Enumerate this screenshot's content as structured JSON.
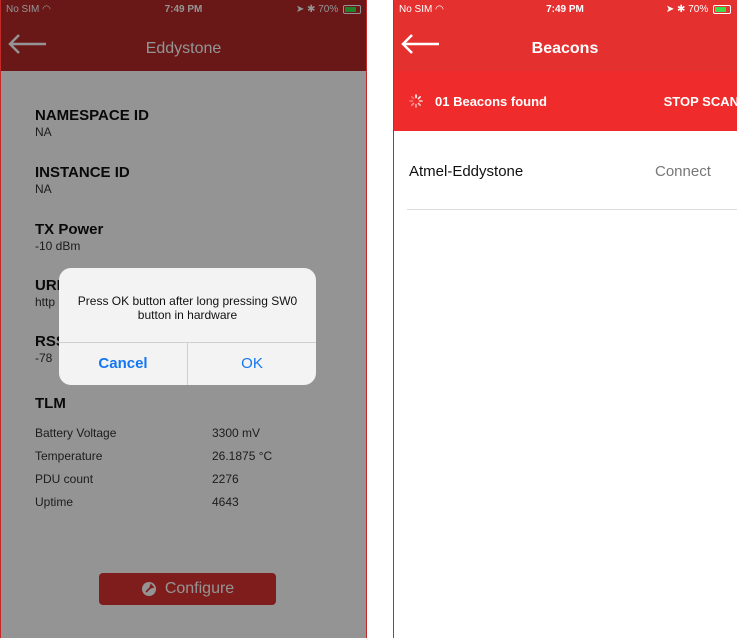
{
  "left_screen": {
    "status": {
      "carrier": "No SIM",
      "time": "7:49 PM",
      "battery": "70%"
    },
    "nav_title": "Eddystone",
    "sections": [
      {
        "title": "NAMESPACE ID",
        "value": "NA"
      },
      {
        "title": "INSTANCE ID",
        "value": "NA"
      },
      {
        "title": "TX Power",
        "value": "-10 dBm"
      },
      {
        "title": "URL",
        "value": "http"
      },
      {
        "title": "RSSI",
        "value": "-78"
      }
    ],
    "tlm": {
      "title": "TLM",
      "rows": [
        {
          "label": "Battery Voltage",
          "value": "3300 mV"
        },
        {
          "label": "Temperature",
          "value": "26.1875 °C"
        },
        {
          "label": "PDU count",
          "value": "2276"
        },
        {
          "label": "Uptime",
          "value": "4643"
        }
      ]
    },
    "configure_label": "Configure",
    "dialog": {
      "message": "Press OK button after long pressing SW0 button in hardware",
      "cancel_label": "Cancel",
      "ok_label": "OK"
    }
  },
  "right_screen": {
    "status": {
      "carrier": "No SIM",
      "time": "7:49 PM",
      "battery": "70%"
    },
    "nav_title": "Beacons",
    "scan_status": "01 Beacons found",
    "stop_scan_label": "STOP SCAN",
    "beacons": [
      {
        "name": "Atmel-Eddystone",
        "action": "Connect"
      }
    ]
  },
  "colors": {
    "header": "#b52828",
    "scan_bar": "#f02b2b",
    "configure_button": "#d9322f",
    "dialog_button": "#1476f2"
  },
  "icons": [
    "wifi-icon",
    "location-icon",
    "bluetooth-icon",
    "battery-icon",
    "back-arrow-icon",
    "gear-icon",
    "spinner-icon"
  ]
}
